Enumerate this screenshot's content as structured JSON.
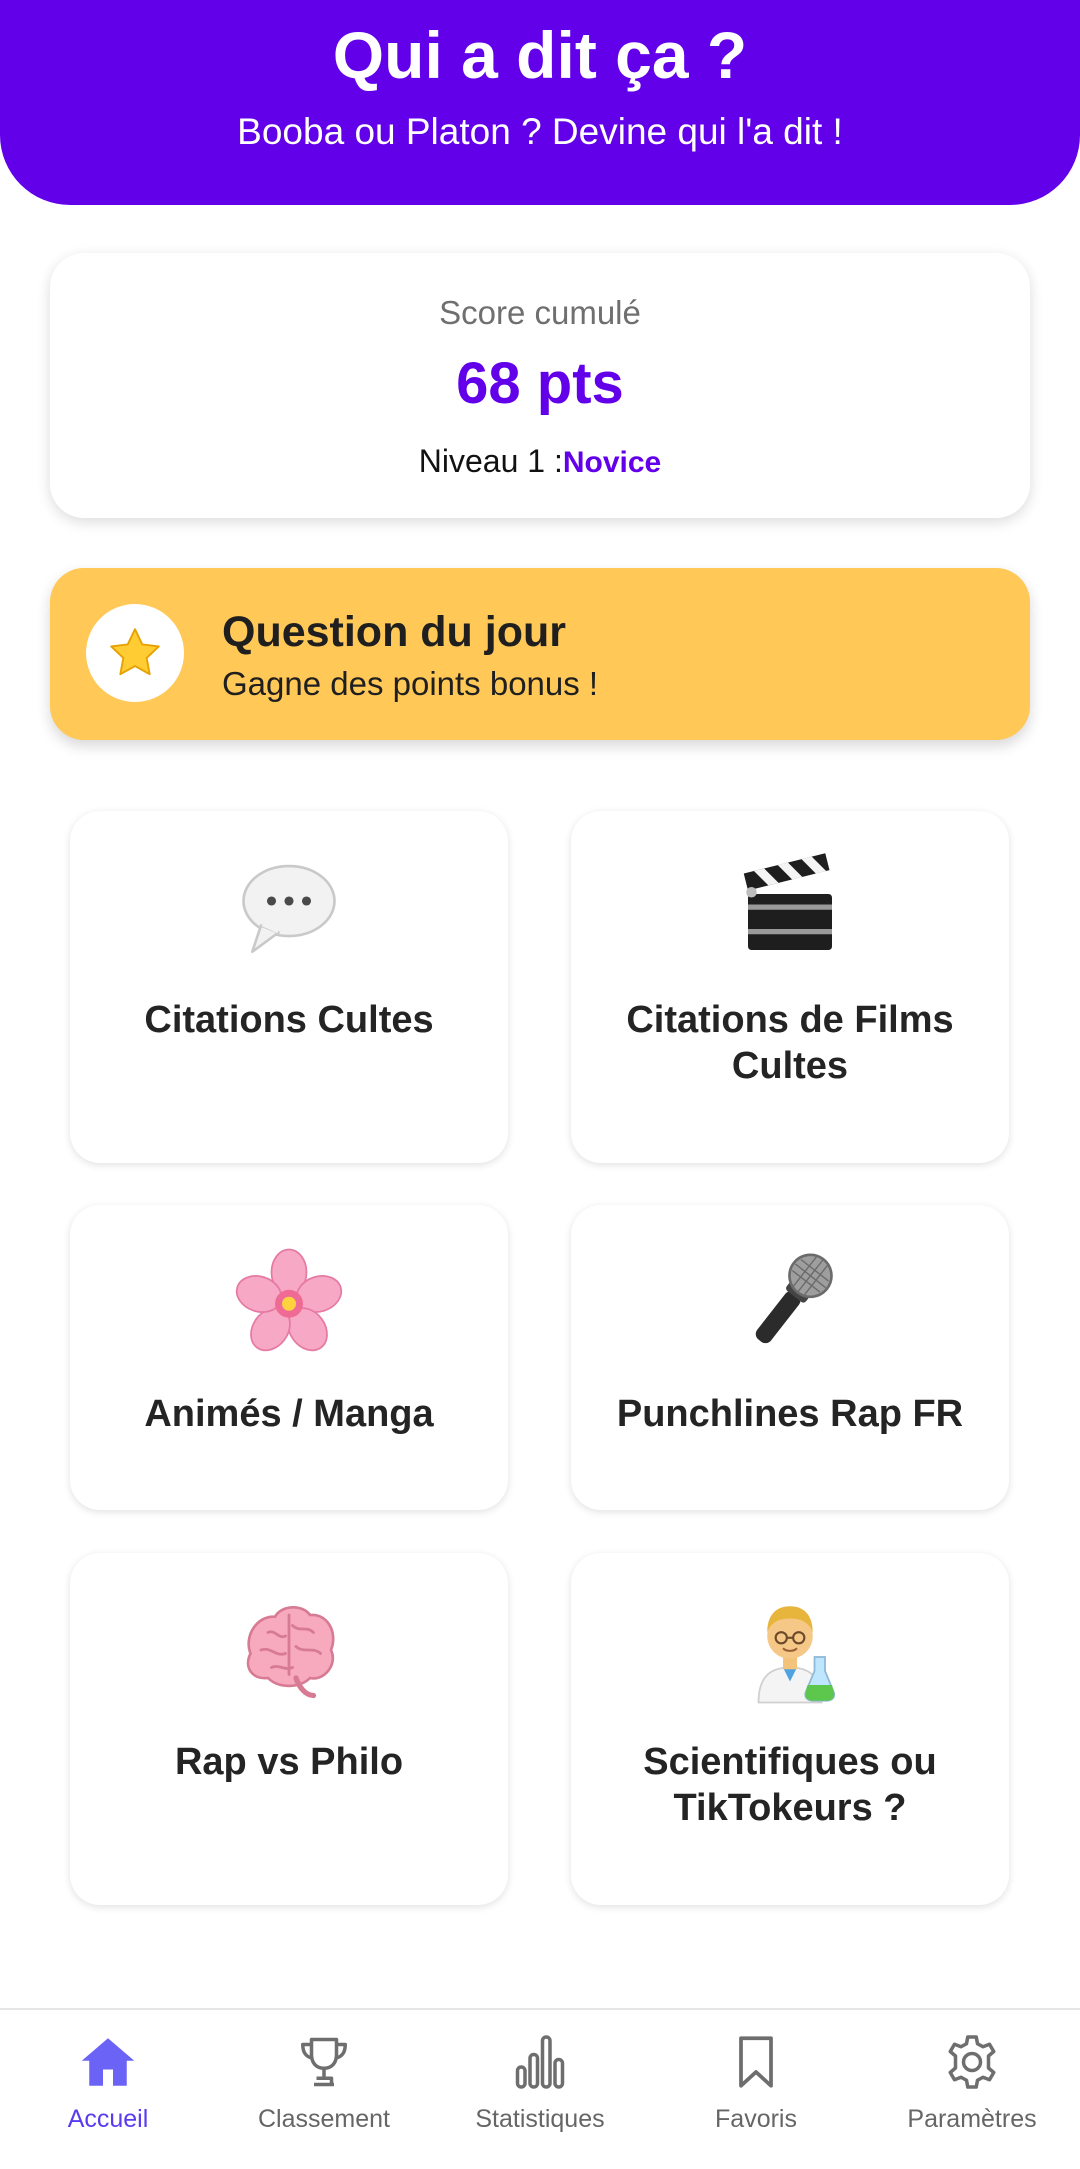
{
  "header": {
    "title": "Qui a dit ça ?",
    "subtitle": "Booba ou Platon ? Devine qui l'a dit !"
  },
  "score": {
    "label": "Score cumulé",
    "value": "68 pts",
    "level_prefix": "Niveau 1 :",
    "level_name": "Novice"
  },
  "daily": {
    "icon": "star-icon",
    "title": "Question du jour",
    "subtitle": "Gagne des points bonus !"
  },
  "categories": [
    {
      "icon": "speech-bubble-icon",
      "label": "Citations Cultes"
    },
    {
      "icon": "clapperboard-icon",
      "label": "Citations de Films Cultes"
    },
    {
      "icon": "cherry-blossom-icon",
      "label": "Animés / Manga"
    },
    {
      "icon": "microphone-icon",
      "label": "Punchlines Rap FR"
    },
    {
      "icon": "brain-icon",
      "label": "Rap vs Philo"
    },
    {
      "icon": "scientist-icon",
      "label": "Scientifiques ou TikTokeurs ?"
    }
  ],
  "nav": [
    {
      "icon": "home-icon",
      "label": "Accueil",
      "active": true
    },
    {
      "icon": "trophy-icon",
      "label": "Classement",
      "active": false
    },
    {
      "icon": "bar-chart-icon",
      "label": "Statistiques",
      "active": false
    },
    {
      "icon": "bookmark-icon",
      "label": "Favoris",
      "active": false
    },
    {
      "icon": "gear-icon",
      "label": "Paramètres",
      "active": false
    }
  ],
  "colors": {
    "brand": "#6200ea",
    "daily_bg": "#ffc857",
    "nav_active": "#5b3bf0",
    "nav_inactive": "#666666"
  }
}
